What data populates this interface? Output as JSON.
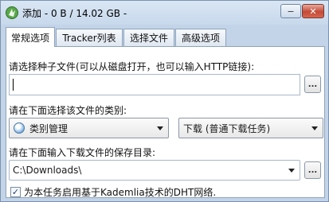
{
  "window": {
    "title": "添加 - 0 B / 14.02 GB -",
    "minimize_label": "−",
    "close_label": "✕"
  },
  "tabs": [
    {
      "label": "常规选项",
      "active": true
    },
    {
      "label": "Tracker列表",
      "active": false
    },
    {
      "label": "选择文件",
      "active": false
    },
    {
      "label": "高级选项",
      "active": false
    }
  ],
  "torrent": {
    "label": "请选择种子文件(可以从磁盘打开，也可以输入HTTP链接):",
    "value": "",
    "browse_label": "..."
  },
  "category": {
    "label": "请在下面选择该文件的类别:",
    "selected": "类别管理",
    "icon": "category-icon",
    "download_type": "下载 (普通下载任务)"
  },
  "save_dir": {
    "label": "请在下面输入下载文件的保存目录:",
    "value": "C:\\Downloads\\",
    "browse_label": "..."
  },
  "dht": {
    "label": "为本任务启用基于Kademlia技术的DHT网络.",
    "checked": true,
    "check_mark": "✓"
  }
}
